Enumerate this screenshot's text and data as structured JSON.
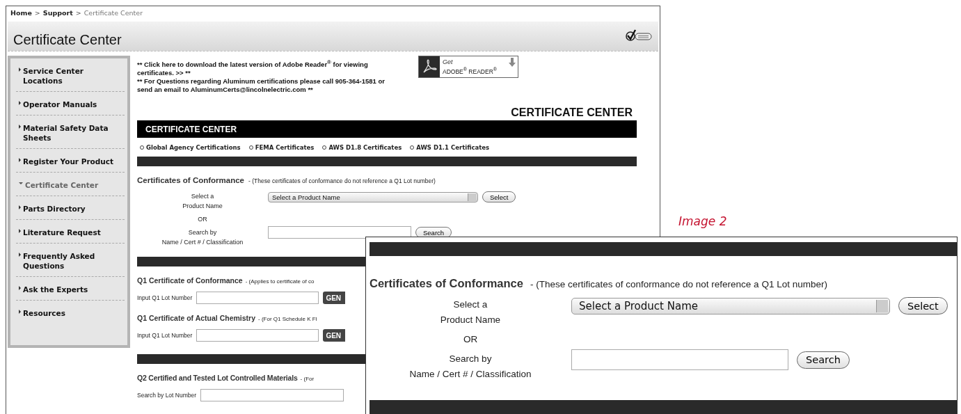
{
  "breadcrumb": {
    "separator": ">",
    "items": [
      {
        "label": "Home",
        "current": false
      },
      {
        "label": "Support",
        "current": false
      },
      {
        "label": "Certificate Center",
        "current": true
      }
    ]
  },
  "page_title": "Certificate Center",
  "sidebar": {
    "items": [
      {
        "label": "Service Center Locations",
        "selected": false
      },
      {
        "label": "Operator Manuals",
        "selected": false
      },
      {
        "label": "Material Safety Data Sheets",
        "selected": false
      },
      {
        "label": "Register Your Product",
        "selected": false
      },
      {
        "label": "Certificate Center",
        "selected": true
      },
      {
        "label": "Parts Directory",
        "selected": false
      },
      {
        "label": "Literature Request",
        "selected": false
      },
      {
        "label": "Frequently Asked Questions",
        "selected": false
      },
      {
        "label": "Ask the Experts",
        "selected": false
      },
      {
        "label": "Resources",
        "selected": false
      }
    ]
  },
  "notices": [
    "** Click here to download the latest version of Adobe Reader$^{®}$ for viewing certificates. >> **",
    "** For Questions regarding Aluminum certifications please call 905-364-1581 or send an email to AluminumCerts@lincolnelectric.com **"
  ],
  "adobe_badge": {
    "get": "Get",
    "name": "ADOBE$^{®}$ READER$^{®}$"
  },
  "section_heading": "CERTIFICATE CENTER",
  "banner_title": "CERTIFICATE CENTER",
  "cert_links": [
    "Global Agency Certifications",
    "FEMA Certificates",
    "AWS D1.8 Certificates",
    "AWS D1.1 Certificates"
  ],
  "conformance": {
    "title": "Certificates of Conformance",
    "note": "- (These certificates of conformance do not reference a Q1 Lot number)",
    "select_label": [
      "Select a",
      "Product Name"
    ],
    "dropdown": "Select a Product Name",
    "select_button": "Select",
    "or": "OR",
    "search_label": [
      "Search by",
      "Name / Cert # / Classification"
    ],
    "search_button": "Search"
  },
  "q1_sections": [
    {
      "title": "Q1 Certificate of Conformance",
      "note": "- (Applies to certificate of co",
      "input_label": "Input Q1 Lot Number",
      "button": "GEN"
    },
    {
      "title": "Q1 Certificate of Actual Chemistry",
      "note": "- (For Q1 Schedule K Fl",
      "input_label": "Input Q1 Lot Number",
      "button": "GEN"
    }
  ],
  "q2": {
    "title": "Q2 Certified and Tested Lot Controlled Materials",
    "note": "- (For",
    "input_label": "Search by Lot Number"
  },
  "caption": "Image 2",
  "image2": {
    "title": "Certificates of Conformance",
    "note": "- (These certificates of conformance do not reference a Q1 Lot number)",
    "select_label": [
      "Select a",
      "Product Name"
    ],
    "dropdown": "Select a Product Name",
    "select_button": "Select",
    "or": "OR",
    "search_label": [
      "Search by",
      "Name / Cert # / Classification"
    ],
    "search_button": "Search"
  }
}
